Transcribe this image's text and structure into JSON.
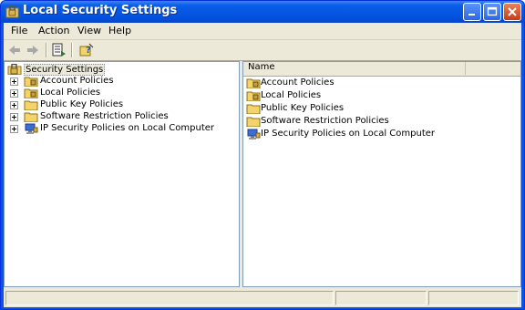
{
  "window": {
    "title": "Local Security Settings",
    "icon": "security-settings-icon"
  },
  "menu": [
    "File",
    "Action",
    "View",
    "Help"
  ],
  "toolbar": {
    "icons": [
      "back-arrow-icon",
      "forward-arrow-icon",
      "export-list-icon",
      "help-icon"
    ]
  },
  "tree": {
    "root": "Security Settings",
    "items": [
      {
        "label": "Account Policies",
        "icon": "folder-lock-icon"
      },
      {
        "label": "Local Policies",
        "icon": "folder-lock-icon"
      },
      {
        "label": "Public Key Policies",
        "icon": "folder-icon"
      },
      {
        "label": "Software Restriction Policies",
        "icon": "folder-icon"
      },
      {
        "label": "IP Security Policies on Local Computer",
        "icon": "ip-security-icon"
      }
    ]
  },
  "list": {
    "column_header": "Name",
    "items": [
      {
        "label": "Account Policies",
        "icon": "folder-lock-icon"
      },
      {
        "label": "Local Policies",
        "icon": "folder-lock-icon"
      },
      {
        "label": "Public Key Policies",
        "icon": "folder-icon"
      },
      {
        "label": "Software Restriction Policies",
        "icon": "folder-icon"
      },
      {
        "label": "IP Security Policies on Local Computer",
        "icon": "ip-security-icon"
      }
    ]
  },
  "colors": {
    "title_bar": "#0353e0",
    "chrome": "#ece9d8",
    "folder": "#f4d36b"
  }
}
